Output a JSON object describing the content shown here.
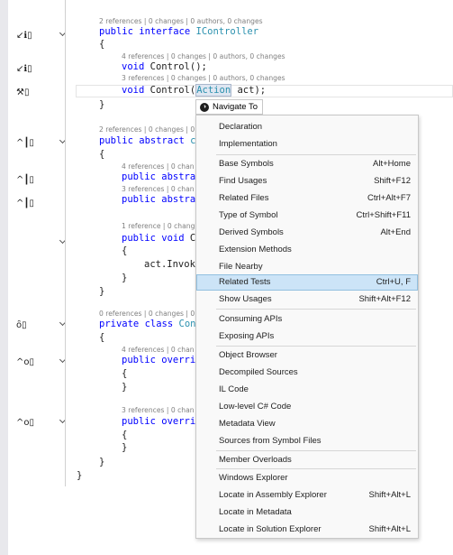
{
  "code": {
    "lens": [
      "2 references | 0 changes | 0 authors, 0 changes",
      "4 references | 0 changes | 0 authors, 0 changes",
      "3 references | 0 changes | 0 authors, 0 changes",
      "2 references | 0 changes | 0",
      "4 references | 0 chan",
      "3 references | 0 chan",
      "1 reference | 0 chang",
      "0 references | 0 changes | 0",
      "4 references | 0 chan",
      "3 references | 0 chan"
    ],
    "tokens": {
      "public": "public",
      "interface": "interface",
      "IController": "IController",
      "void": "void",
      "Control": "Control",
      "Action": "Action",
      "act": "act",
      "abstract": "abstract",
      "c_trunc": "c",
      "abstra_trunc": "abstra",
      "C_trunc": "C",
      "act_invoke": "act.Invok",
      "private": "private",
      "class": "class",
      "Con_trunc": "Con",
      "overri_trunc": "overri"
    },
    "punct": {
      "open_brace": "{",
      "close_brace": "}",
      "parens_semicolon": "();",
      "open_paren": "(",
      "close_paren_semicolon": ");",
      "space": " "
    }
  },
  "navigate_chip": {
    "label": "Navigate To"
  },
  "menu": {
    "items": [
      {
        "label": "Declaration",
        "shortcut": ""
      },
      {
        "label": "Implementation",
        "shortcut": ""
      },
      {
        "label": "Base Symbols",
        "shortcut": "Alt+Home"
      },
      {
        "label": "Find Usages",
        "shortcut": "Shift+F12"
      },
      {
        "label": "Related Files",
        "shortcut": "Ctrl+Alt+F7"
      },
      {
        "label": "Type of Symbol",
        "shortcut": "Ctrl+Shift+F11"
      },
      {
        "label": "Derived Symbols",
        "shortcut": "Alt+End"
      },
      {
        "label": "Extension Methods",
        "shortcut": ""
      },
      {
        "label": "File Nearby",
        "shortcut": ""
      },
      {
        "label": "Related Tests",
        "shortcut": "Ctrl+U, F"
      },
      {
        "label": "Show Usages",
        "shortcut": "Shift+Alt+F12"
      },
      {
        "label": "Consuming APIs",
        "shortcut": ""
      },
      {
        "label": "Exposing APIs",
        "shortcut": ""
      },
      {
        "label": "Object Browser",
        "shortcut": ""
      },
      {
        "label": "Decompiled Sources",
        "shortcut": ""
      },
      {
        "label": "IL Code",
        "shortcut": ""
      },
      {
        "label": "Low-level C# Code",
        "shortcut": ""
      },
      {
        "label": "Metadata View",
        "shortcut": ""
      },
      {
        "label": "Sources from Symbol Files",
        "shortcut": ""
      },
      {
        "label": "Member Overloads",
        "shortcut": ""
      },
      {
        "label": "Windows Explorer",
        "shortcut": ""
      },
      {
        "label": "Locate in Assembly Explorer",
        "shortcut": "Shift+Alt+L"
      },
      {
        "label": "Locate in Metadata",
        "shortcut": ""
      },
      {
        "label": "Locate in Solution Explorer",
        "shortcut": "Shift+Alt+L"
      }
    ],
    "selected": "Related Tests"
  },
  "colors": {
    "keyword": "#0000ff",
    "type": "#2b91af",
    "lens": "#808080",
    "selection": "#cce4f7"
  }
}
